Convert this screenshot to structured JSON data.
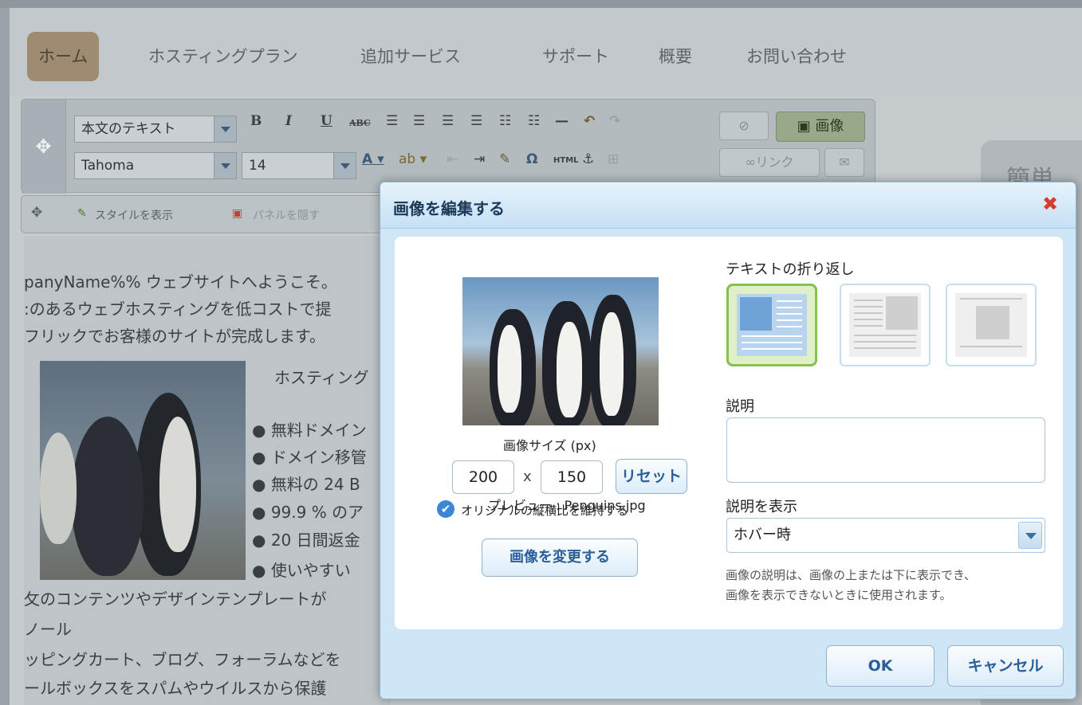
{
  "nav": {
    "items": [
      "ホーム",
      "ホスティングプラン",
      "追加サービス",
      "サポート",
      "概要",
      "お問い合わせ"
    ]
  },
  "toolbar": {
    "format_select": "本文のテキスト",
    "font_select": "Tahoma",
    "size_select": "14",
    "image_button": "画像",
    "link_button": "リンク",
    "html_label": "HTML"
  },
  "subbar": {
    "show_style": "スタイルを表示",
    "hide_panel": "パネルを隠す"
  },
  "content": {
    "lines": [
      "panyName%% ウェブサイトへようこそ。",
      ":のあるウェブホスティングを低コストで提",
      "フリックでお客様のサイトが完成します。"
    ],
    "hosting_heading": "ホスティング",
    "bullets": [
      "無料ドメイン",
      "ドメイン移管",
      "無料の 24 B",
      "99.9 % のア",
      "20 日間返金",
      "使いやすい"
    ],
    "footer_lines": [
      "攵のコンテンツやデザインテンプレートが",
      "ノール",
      "ッピングカート、ブログ、フォーラムなどを",
      "ールボックスをスパムやウイルスから保護"
    ]
  },
  "right_panel": {
    "title": "簡単"
  },
  "dialog": {
    "title": "画像を編集する",
    "preview_label": "プレビュー : Penguins.jpg",
    "size_label": "画像サイズ (px)",
    "width": "200",
    "x_sep": "x",
    "height": "150",
    "reset_button": "リセット",
    "keep_ratio_label": "オリジナルの縦横比を維持する",
    "keep_ratio_checked": true,
    "change_image_button": "画像を変更する",
    "wrap_label": "テキストの折り返し",
    "description_label": "説明",
    "description_value": "",
    "show_description_label": "説明を表示",
    "show_description_value": "ホバー時",
    "help_line1": "画像の説明は、画像の上または下に表示でき、",
    "help_line2": "画像を表示できないときに使用されます。",
    "ok_button": "OK",
    "cancel_button": "キャンセル"
  },
  "colors": {
    "dialog_header": "#c5e0f5",
    "selected_wrap": "#86c04e",
    "button_text": "#2a5f99",
    "close_icon": "#d63b2f"
  }
}
